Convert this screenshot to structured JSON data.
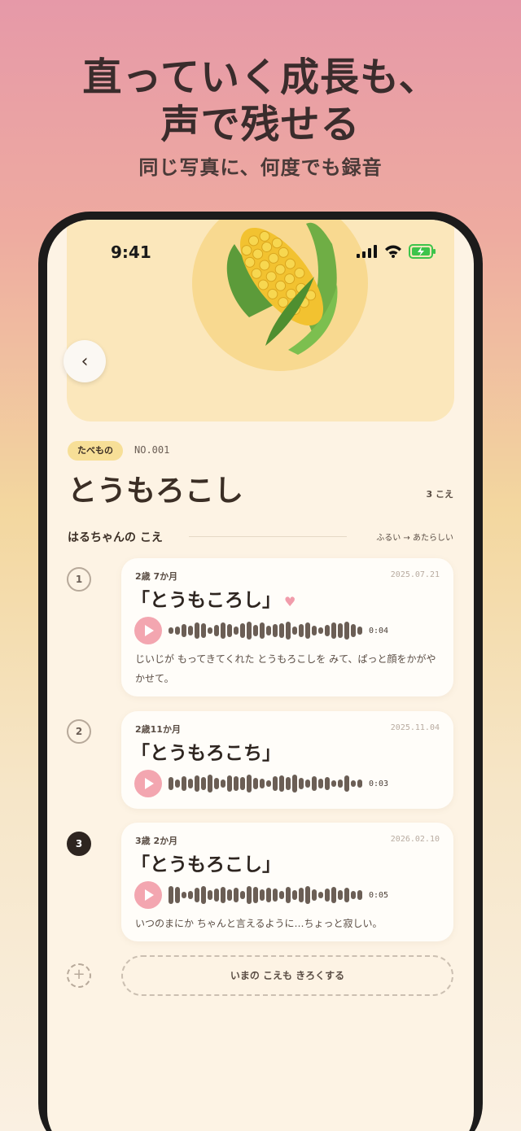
{
  "headline": {
    "line1": "直っていく成長も、",
    "line2": "声で残せる"
  },
  "subheadline": "同じ写真に、何度でも録音",
  "status_bar": {
    "time": "9:41"
  },
  "item": {
    "category": "たべもの",
    "number": "NO.001",
    "title": "とうもろこし",
    "voice_count": "3 こえ"
  },
  "section": {
    "title": "はるちゃんの こえ",
    "order": "ふるい → あたらしい"
  },
  "recordings": [
    {
      "step": "1",
      "age": "2歳 7か月",
      "date": "2025.07.21",
      "phrase": "「とうもころし」",
      "favorite": true,
      "duration": "0:04",
      "note": "じいじが もってきてくれた とうもろこしを みて、ぱっと顔をかがやかせて。",
      "current": false
    },
    {
      "step": "2",
      "age": "2歳11か月",
      "date": "2025.11.04",
      "phrase": "「とうもろこち」",
      "favorite": false,
      "duration": "0:03",
      "note": "",
      "current": false
    },
    {
      "step": "3",
      "age": "3歳 2か月",
      "date": "2026.02.10",
      "phrase": "「とうもろこし」",
      "favorite": false,
      "duration": "0:05",
      "note": "いつのまにか ちゃんと言えるように…ちょっと寂しい。",
      "current": true
    }
  ],
  "record_button": "いまの こえも きろくする",
  "colors": {
    "accent_pink": "#f3a6b0",
    "tag_yellow": "#f7df97",
    "text_dark": "#3b2e25"
  }
}
